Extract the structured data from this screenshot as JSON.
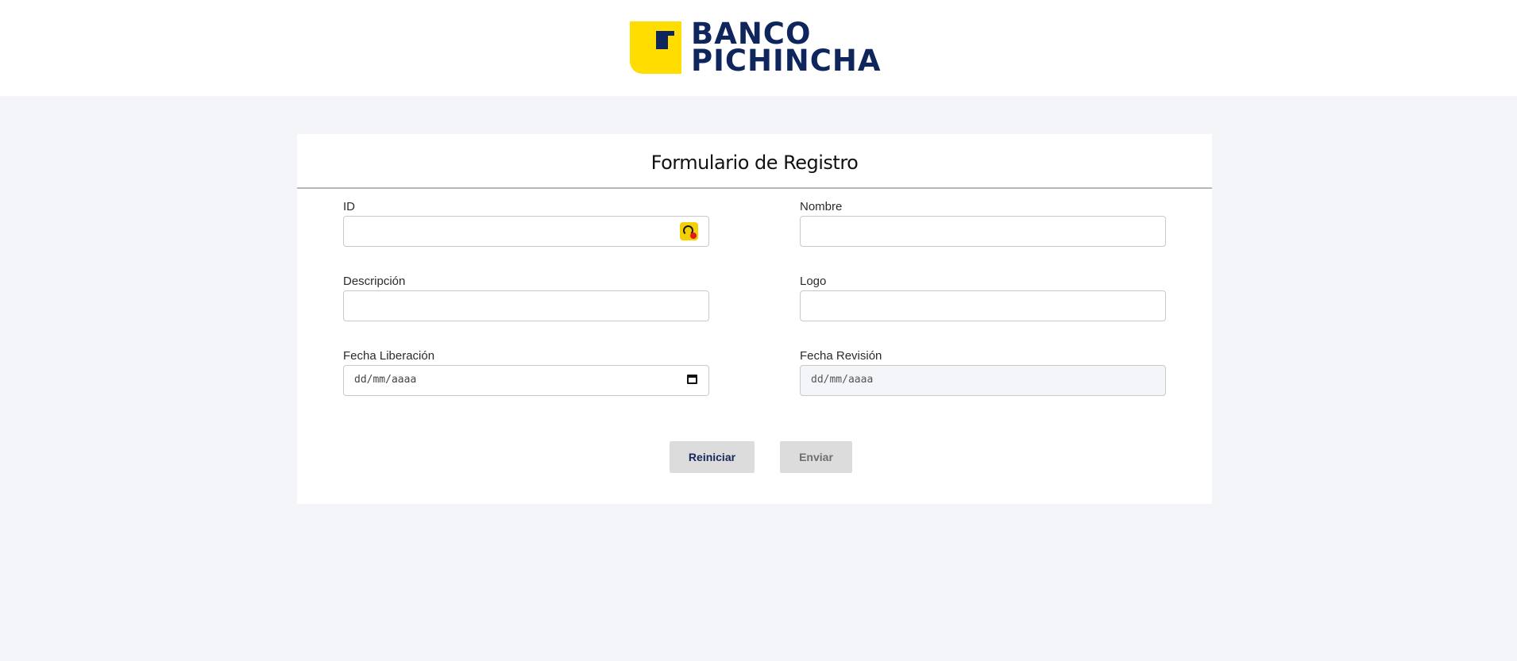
{
  "brand": {
    "name_line1": "BANCO",
    "name_line2": "PICHINCHA",
    "colors": {
      "yellow": "#ffdd00",
      "navy": "#0f265c"
    }
  },
  "form": {
    "title": "Formulario de Registro",
    "fields": {
      "id": {
        "label": "ID",
        "value": ""
      },
      "nombre": {
        "label": "Nombre",
        "value": ""
      },
      "descripcion": {
        "label": "Descripción",
        "value": ""
      },
      "logo": {
        "label": "Logo",
        "value": ""
      },
      "fecha_liberacion": {
        "label": "Fecha Liberación",
        "placeholder": "dd/mm/aaaa"
      },
      "fecha_revision": {
        "label": "Fecha Revisión",
        "placeholder": "dd/mm/aaaa",
        "disabled": true
      }
    },
    "buttons": {
      "reset": "Reiniciar",
      "submit": "Enviar"
    }
  },
  "icons": {
    "id_field_icon": "password-manager-icon",
    "date_field_icon": "calendar-icon"
  }
}
